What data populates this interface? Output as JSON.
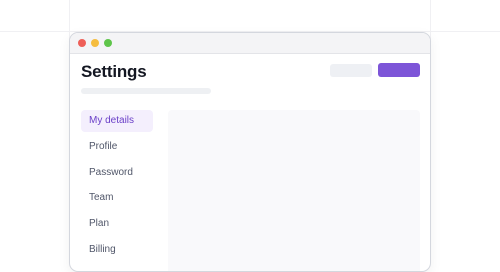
{
  "window": {
    "traffic_lights": [
      {
        "name": "close",
        "color": "#ee5f58"
      },
      {
        "name": "minimize",
        "color": "#f5bd3f"
      },
      {
        "name": "maximize",
        "color": "#5ec54a"
      }
    ]
  },
  "header": {
    "title": "Settings"
  },
  "colors": {
    "accent": "#7d55d8",
    "active_nav_bg": "#f4effd",
    "active_nav_text": "#6a3fc8"
  },
  "sidebar": {
    "items": [
      {
        "label": "My details",
        "active": true
      },
      {
        "label": "Profile",
        "active": false
      },
      {
        "label": "Password",
        "active": false
      },
      {
        "label": "Team",
        "active": false
      },
      {
        "label": "Plan",
        "active": false
      },
      {
        "label": "Billing",
        "active": false
      }
    ]
  }
}
